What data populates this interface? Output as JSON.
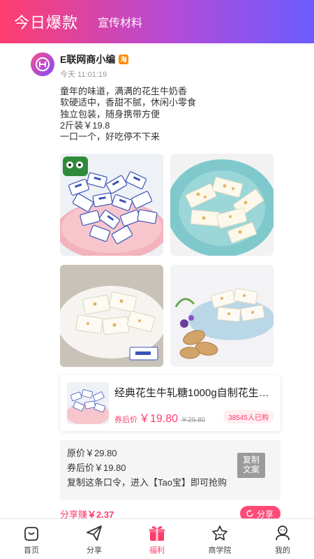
{
  "header": {
    "tab_active": "今日爆款",
    "tab_other": "宣传材料"
  },
  "post": {
    "author_name": "E联网商小编",
    "author_badge": "淘",
    "time": "今天 11:01:19",
    "description": [
      "童年的味道，满满的花生牛奶香",
      "软硬适中，香甜不腻，休闲小零食",
      "独立包装，随身携带方便",
      "2斤装￥19.8",
      "一口一个，好吃停不下来"
    ]
  },
  "product": {
    "title": "经典花生牛轧糖1000g自制花生牛...",
    "coupon_label": "券后价",
    "price": "￥19.80",
    "original_price": "￥29.80",
    "sold": "38545人已购"
  },
  "copy_text": {
    "original_price_line": "原价￥29.80",
    "coupon_price_line": "券后价￥19.80",
    "instruction_line": "复制这条口令，进入【Tao宝】即可抢购",
    "copy_button_line1": "复制",
    "copy_button_line2": "文案"
  },
  "share": {
    "earn_label": "分享赚",
    "earn_value": "￥2.37",
    "button_label": "分享"
  },
  "nav": {
    "items": [
      {
        "label": "首页",
        "icon": "home-icon"
      },
      {
        "label": "分享",
        "icon": "paper-plane-icon"
      },
      {
        "label": "福利",
        "icon": "gift-icon"
      },
      {
        "label": "商学院",
        "icon": "star-icon"
      },
      {
        "label": "我的",
        "icon": "user-icon"
      }
    ],
    "active_index": 2
  },
  "colors": {
    "accent": "#ff3b6a",
    "gradient_start": "#ff3d6e",
    "gradient_end": "#6a5cff"
  }
}
